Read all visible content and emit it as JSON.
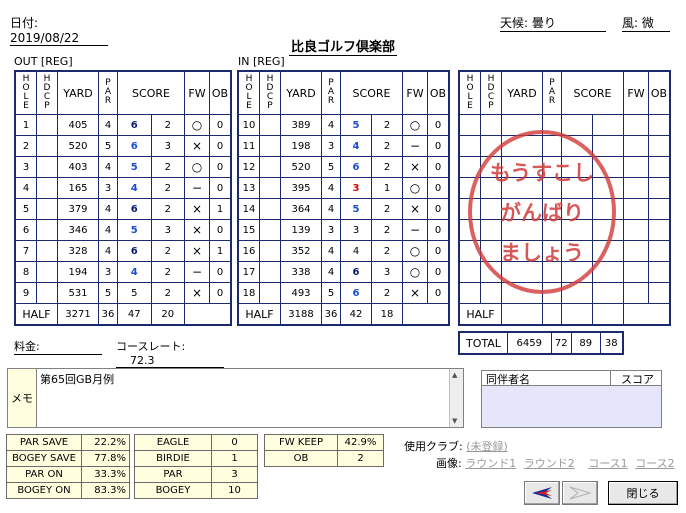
{
  "header": {
    "date_label": "日付: 2019/08/22",
    "weather_label": "天候: 曇り",
    "wind_label": "風: 微",
    "club_name": "比良ゴルフ倶楽部"
  },
  "out": {
    "caption": "OUT [REG]",
    "columns": [
      "HOLE",
      "HDCP",
      "YARD",
      "PAR",
      "SCORE",
      "FW",
      "OB"
    ],
    "rows": [
      {
        "hole": "1",
        "yard": "405",
        "par": "4",
        "score": "6",
        "putts": "2",
        "fw": "○",
        "ob": "0",
        "style": "dark"
      },
      {
        "hole": "2",
        "yard": "520",
        "par": "5",
        "score": "6",
        "putts": "3",
        "fw": "×",
        "ob": "0",
        "style": "blue"
      },
      {
        "hole": "3",
        "yard": "403",
        "par": "4",
        "score": "5",
        "putts": "2",
        "fw": "○",
        "ob": "0",
        "style": "blue"
      },
      {
        "hole": "4",
        "yard": "165",
        "par": "3",
        "score": "4",
        "putts": "2",
        "fw": "−",
        "ob": "0",
        "style": "blue"
      },
      {
        "hole": "5",
        "yard": "379",
        "par": "4",
        "score": "6",
        "putts": "2",
        "fw": "×",
        "ob": "1",
        "style": "dark"
      },
      {
        "hole": "6",
        "yard": "346",
        "par": "4",
        "score": "5",
        "putts": "3",
        "fw": "×",
        "ob": "0",
        "style": "blue"
      },
      {
        "hole": "7",
        "yard": "328",
        "par": "4",
        "score": "6",
        "putts": "2",
        "fw": "×",
        "ob": "1",
        "style": "dark"
      },
      {
        "hole": "8",
        "yard": "194",
        "par": "3",
        "score": "4",
        "putts": "2",
        "fw": "−",
        "ob": "0",
        "style": "blue"
      },
      {
        "hole": "9",
        "yard": "531",
        "par": "5",
        "score": "5",
        "putts": "2",
        "fw": "×",
        "ob": "0",
        "style": "plain"
      }
    ],
    "half": {
      "label": "HALF",
      "yard": "3271",
      "par": "36",
      "score": "47",
      "putts": "20"
    }
  },
  "in": {
    "caption": "IN [REG]",
    "columns": [
      "HOLE",
      "HDCP",
      "YARD",
      "PAR",
      "SCORE",
      "FW",
      "OB"
    ],
    "rows": [
      {
        "hole": "10",
        "yard": "389",
        "par": "4",
        "score": "5",
        "putts": "2",
        "fw": "○",
        "ob": "0",
        "style": "blue"
      },
      {
        "hole": "11",
        "yard": "198",
        "par": "3",
        "score": "4",
        "putts": "2",
        "fw": "−",
        "ob": "0",
        "style": "blue"
      },
      {
        "hole": "12",
        "yard": "520",
        "par": "5",
        "score": "6",
        "putts": "2",
        "fw": "×",
        "ob": "0",
        "style": "blue"
      },
      {
        "hole": "13",
        "yard": "395",
        "par": "4",
        "score": "3",
        "putts": "1",
        "fw": "○",
        "ob": "0",
        "style": "red"
      },
      {
        "hole": "14",
        "yard": "364",
        "par": "4",
        "score": "5",
        "putts": "2",
        "fw": "×",
        "ob": "0",
        "style": "blue"
      },
      {
        "hole": "15",
        "yard": "139",
        "par": "3",
        "score": "3",
        "putts": "2",
        "fw": "−",
        "ob": "0",
        "style": "plain"
      },
      {
        "hole": "16",
        "yard": "352",
        "par": "4",
        "score": "4",
        "putts": "2",
        "fw": "○",
        "ob": "0",
        "style": "plain"
      },
      {
        "hole": "17",
        "yard": "338",
        "par": "4",
        "score": "6",
        "putts": "3",
        "fw": "○",
        "ob": "0",
        "style": "dark"
      },
      {
        "hole": "18",
        "yard": "493",
        "par": "5",
        "score": "6",
        "putts": "2",
        "fw": "×",
        "ob": "0",
        "style": "blue"
      }
    ],
    "half": {
      "label": "HALF",
      "yard": "3188",
      "par": "36",
      "score": "42",
      "putts": "18"
    }
  },
  "third": {
    "columns": [
      "HOLE",
      "HDCP",
      "YARD",
      "PAR",
      "SCORE",
      "FW",
      "OB"
    ],
    "half_label": "HALF",
    "total": {
      "label": "TOTAL",
      "yard": "6459",
      "par": "72",
      "score": "89",
      "putts": "38"
    },
    "stamp_lines": [
      "もうすこし",
      "がんばり",
      "ましょう"
    ]
  },
  "fee": {
    "label": "料金:",
    "value": ""
  },
  "course_rate": {
    "label": "コースレート:",
    "value": "72.3"
  },
  "memo": {
    "label": "メモ",
    "text": "第65回GB月例"
  },
  "companions": {
    "name_header": "同伴者名",
    "score_header": "スコア"
  },
  "stats": {
    "save": [
      {
        "label": "PAR SAVE",
        "value": "22.2%"
      },
      {
        "label": "BOGEY SAVE",
        "value": "77.8%"
      },
      {
        "label": "PAR ON",
        "value": "33.3%"
      },
      {
        "label": "BOGEY ON",
        "value": "83.3%"
      }
    ],
    "counts": [
      {
        "label": "EAGLE",
        "value": "0"
      },
      {
        "label": "BIRDIE",
        "value": "1"
      },
      {
        "label": "PAR",
        "value": "3"
      },
      {
        "label": "BOGEY",
        "value": "10"
      }
    ],
    "fw": [
      {
        "label": "FW KEEP",
        "value": "42.9%"
      },
      {
        "label": "OB",
        "value": "2"
      }
    ]
  },
  "clubs": {
    "label": "使用クラブ:",
    "link": "(未登録)"
  },
  "images": {
    "label": "画像:",
    "links": [
      "ラウンド1",
      "ラウンド2",
      "コース1",
      "コース2"
    ]
  },
  "buttons": {
    "close": "閉じる"
  },
  "colors": {
    "border": "#1a2a6c",
    "score_blue": "#1a4ecf",
    "score_dark": "#0a1a6a",
    "score_red": "#d40000",
    "stamp": "#d23a3a",
    "stats_bg": "#ffffe0"
  }
}
